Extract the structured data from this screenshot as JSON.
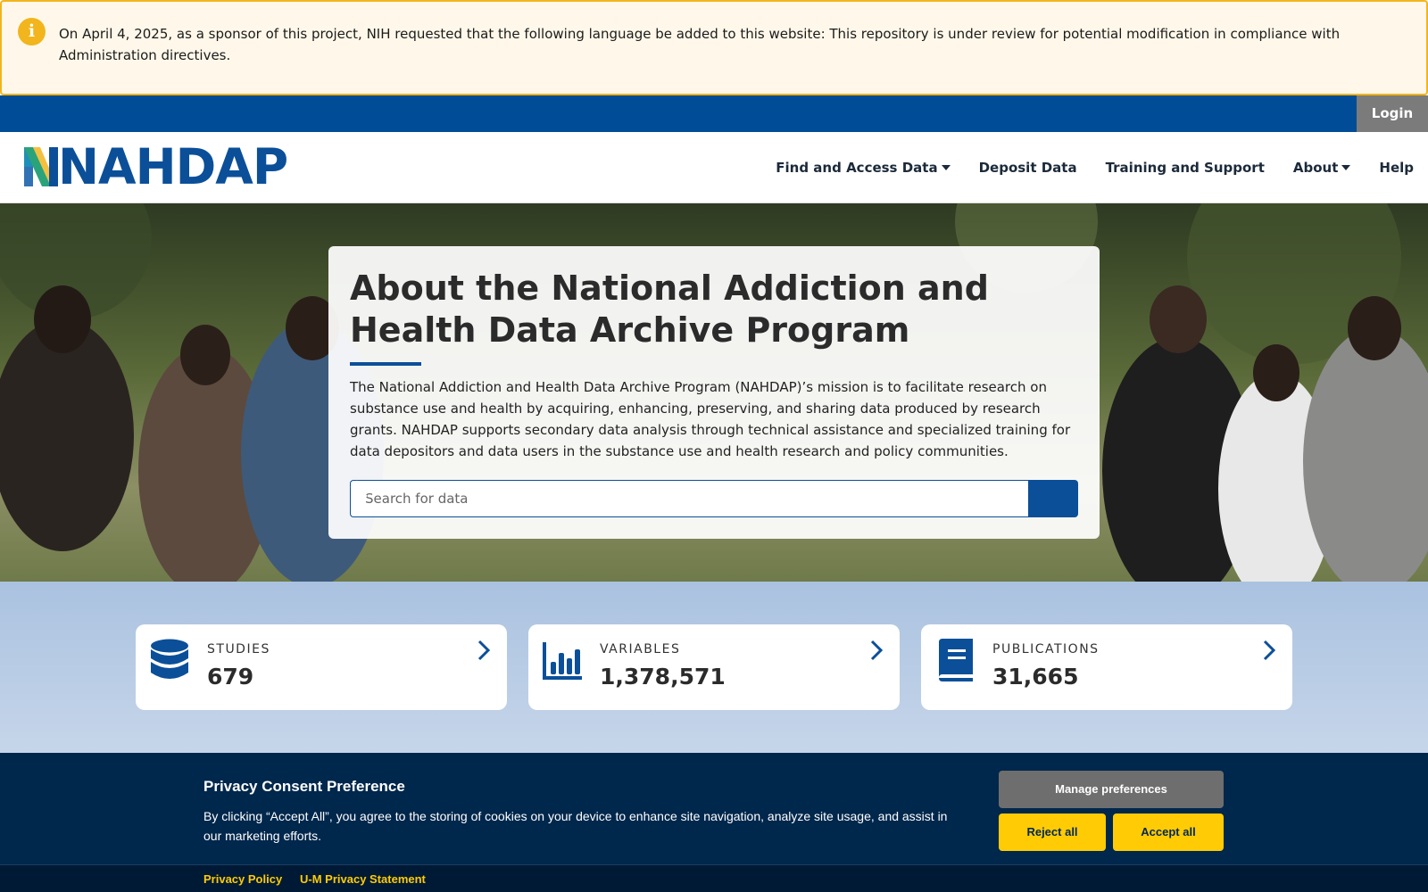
{
  "alert": {
    "icon": "info-icon",
    "text": "On April 4, 2025, as a sponsor of this project, NIH requested that the following language be added to this website: This repository is under review for potential modification in compliance with Administration directives."
  },
  "utility_bar": {
    "login_label": "Login"
  },
  "header": {
    "logo_text": "NAHDAP",
    "nav": [
      {
        "label": "Find and Access Data",
        "dropdown": true
      },
      {
        "label": "Deposit Data",
        "dropdown": false
      },
      {
        "label": "Training and Support",
        "dropdown": false
      },
      {
        "label": "About",
        "dropdown": true
      },
      {
        "label": "Help",
        "dropdown": false
      }
    ]
  },
  "hero": {
    "title": "About the National Addiction and Health Data Archive Program",
    "description": "The National Addiction and Health Data Archive Program (NAHDAP)’s mission is to facilitate research on substance use and health by acquiring, enhancing, preserving, and sharing data produced by research grants. NAHDAP supports secondary data analysis through technical assistance and specialized training for data depositors and data users in the substance use and health research and policy communities.",
    "search": {
      "placeholder": "Search for data",
      "value": "",
      "button_icon": "search-icon"
    }
  },
  "stats": [
    {
      "label": "STUDIES",
      "value": "679",
      "icon": "database-icon"
    },
    {
      "label": "VARIABLES",
      "value": "1,378,571",
      "icon": "bar-chart-icon"
    },
    {
      "label": "PUBLICATIONS",
      "value": "31,665",
      "icon": "book-icon"
    }
  ],
  "consent": {
    "title": "Privacy Consent Preference",
    "text": "By clicking “Accept All”, you agree to the storing of cookies on your device to enhance site navigation, analyze site usage, and assist in our marketing efforts.",
    "manage_label": "Manage preferences",
    "reject_label": "Reject all",
    "accept_label": "Accept all",
    "links": [
      "Privacy Policy",
      "U-M Privacy Statement"
    ]
  },
  "colors": {
    "brand_blue": "#0b4f99",
    "alert_yellow": "#f2b51d",
    "consent_navy": "#00274c",
    "consent_yellow": "#ffcb05"
  }
}
